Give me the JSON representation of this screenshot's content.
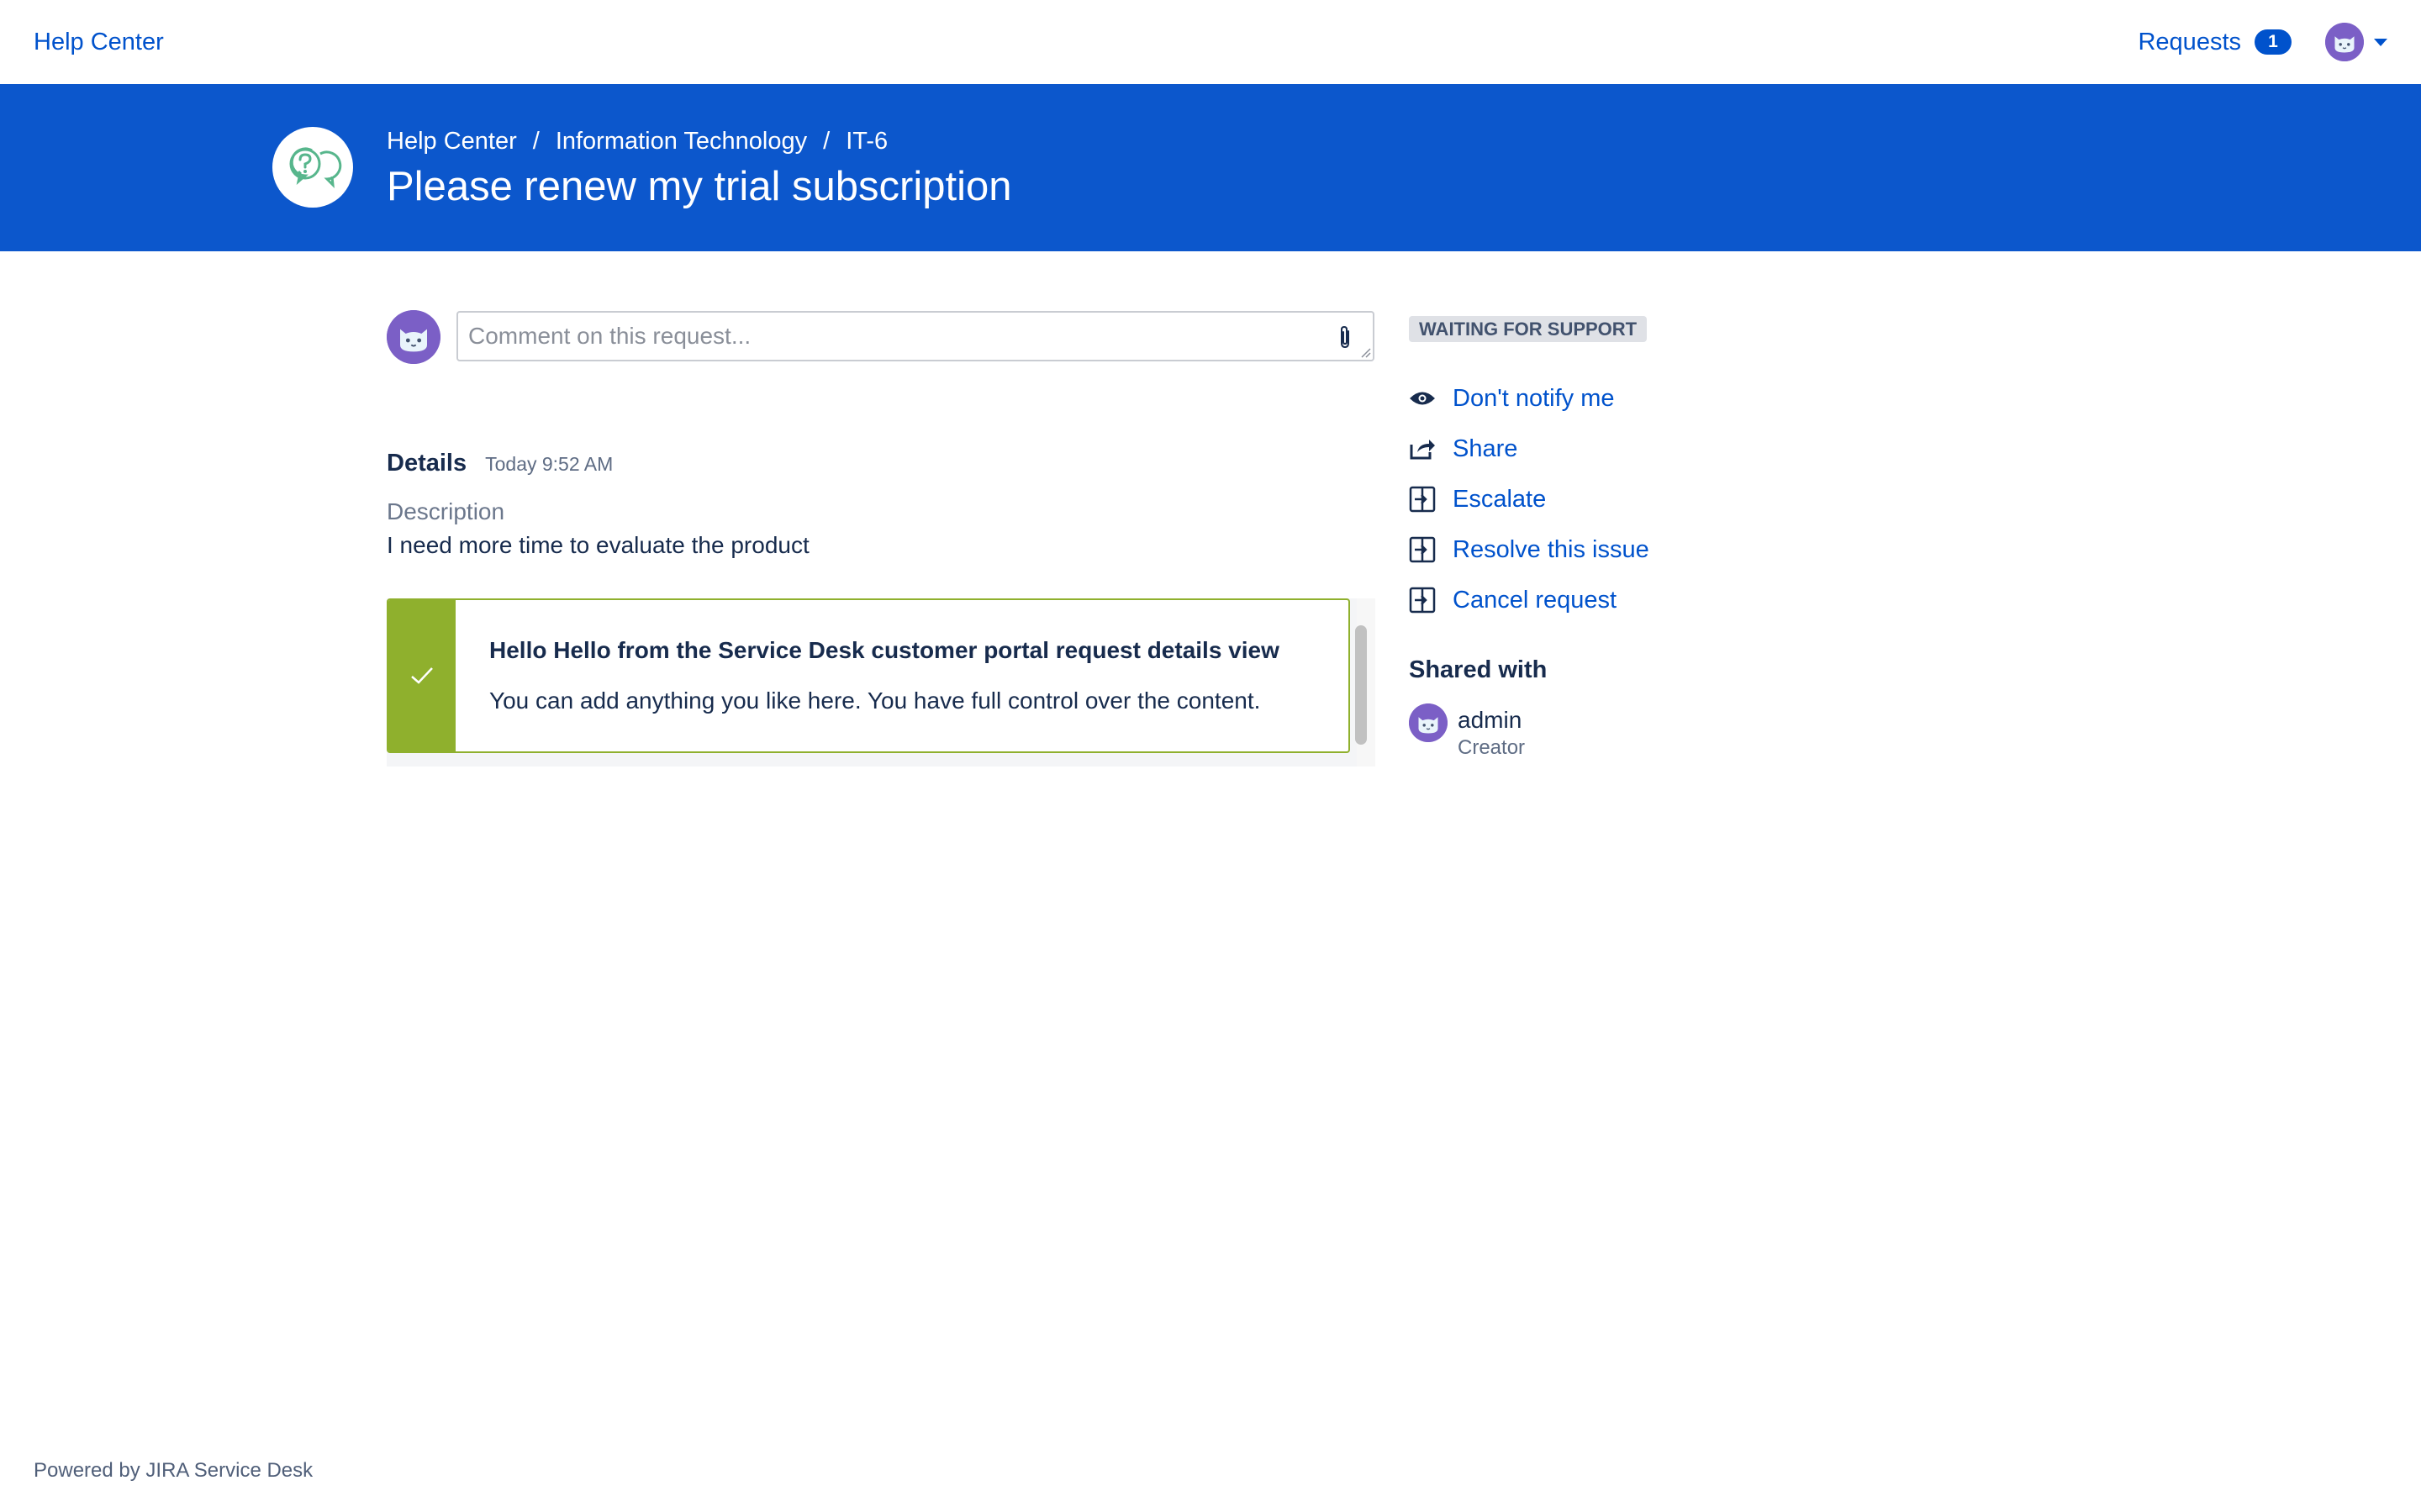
{
  "topnav": {
    "home_label": "Help Center",
    "requests_label": "Requests",
    "requests_count": "1"
  },
  "banner": {
    "breadcrumbs": [
      "Help Center",
      "Information Technology",
      "IT-6"
    ],
    "separator": "/",
    "title": "Please renew my trial subscription"
  },
  "comment": {
    "placeholder": "Comment on this request..."
  },
  "details": {
    "label": "Details",
    "timestamp": "Today 9:52 AM",
    "description_label": "Description",
    "description_value": "I need more time to evaluate the product"
  },
  "panel": {
    "title": "Hello Hello from the Service Desk customer portal request details view",
    "body": "You can add anything you like here. You have full control over the content."
  },
  "sidebar": {
    "status": "WAITING FOR SUPPORT",
    "actions": [
      {
        "label": "Don't notify me",
        "icon": "eye-icon"
      },
      {
        "label": "Share",
        "icon": "share-icon"
      },
      {
        "label": "Escalate",
        "icon": "transition-icon"
      },
      {
        "label": "Resolve this issue",
        "icon": "transition-icon"
      },
      {
        "label": "Cancel request",
        "icon": "transition-icon"
      }
    ],
    "shared_with_title": "Shared with",
    "shared_user": {
      "name": "admin",
      "role": "Creator"
    }
  },
  "footer": {
    "text": "Powered by JIRA Service Desk"
  },
  "colors": {
    "brand_blue": "#0c57cc",
    "link_blue": "#0052cc",
    "success_green": "#8fb02d",
    "avatar_purple": "#7b5fc6"
  }
}
